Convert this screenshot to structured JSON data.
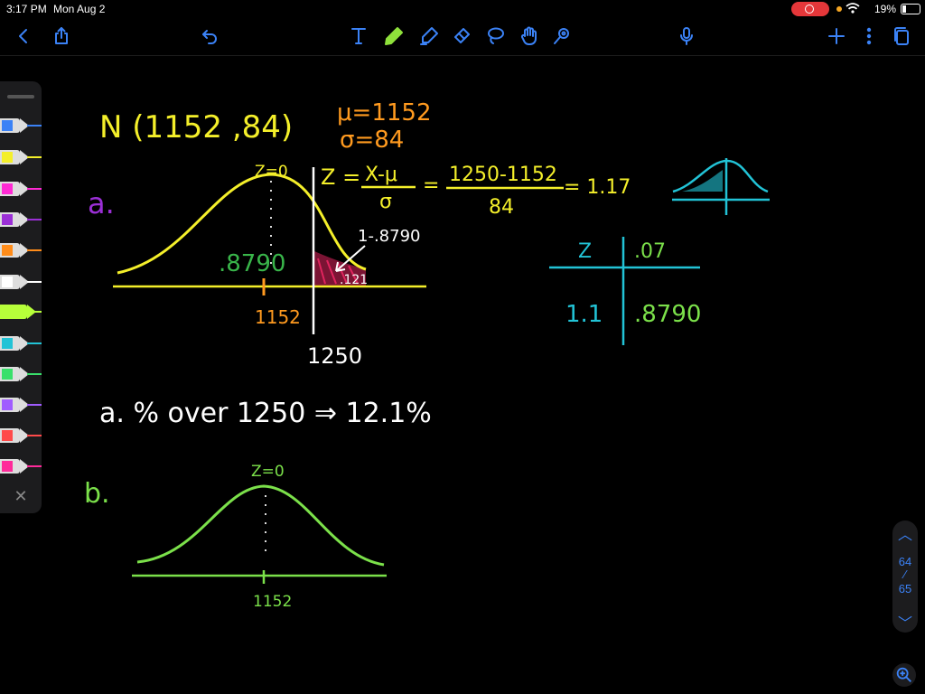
{
  "status_bar": {
    "time": "3:17 PM",
    "date": "Mon Aug 2",
    "battery_percent": "19%",
    "recording": true
  },
  "toolbar": {
    "left_icons": [
      "back-icon",
      "share-icon",
      "undo-icon"
    ],
    "tools": [
      "text-tool-icon",
      "pen-tool-icon",
      "highlighter-tool-icon",
      "eraser-tool-icon",
      "lasso-tool-icon",
      "hand-icon",
      "laser-pointer-icon"
    ],
    "right_icons": [
      "microphone-icon",
      "add-page-icon",
      "more-icon",
      "pages-icon"
    ]
  },
  "palette": {
    "pens": [
      "#ffffff",
      "#fffb00",
      "#ff2ad4",
      "#b030e0",
      "#ff8c1a",
      "#ffffff",
      "#b7ff3a",
      "#23d6d6",
      "#39e06b",
      "#a05cff",
      "#ff4a4a",
      "#ff2a9a"
    ]
  },
  "notes": {
    "dist": "N (1152 ,84)",
    "mu": "μ=1152",
    "sigma": "σ=84",
    "part_a": "a.",
    "z0_a": "Z=0",
    "z_formula_lhs": "Z =",
    "z_num": "X-μ",
    "z_den": "σ",
    "eq1": "=",
    "calc_num": "1250-1152",
    "calc_den": "84",
    "result": "= 1.17",
    "left_area": ".8790",
    "complement": "1-.8790",
    "tail": ".121",
    "mean_a": "1152",
    "x_a": "1250",
    "table_z": "Z",
    "table_col": ".07",
    "table_row": "1.1",
    "table_val": ".8790",
    "answer_a": "a. % over 1250 ⇒ 12.1%",
    "part_b": "b.",
    "z0_b": "Z=0",
    "mean_b": "1152"
  },
  "pager": {
    "current": "64",
    "total": "65"
  },
  "colors": {
    "accent": "#3b82f6",
    "orange": "#ff9a1f",
    "yellow": "#f4ef2a",
    "green": "#7be04a",
    "purple": "#9b2fd6",
    "cyan": "#22c3d6",
    "pink": "#e0245e"
  }
}
